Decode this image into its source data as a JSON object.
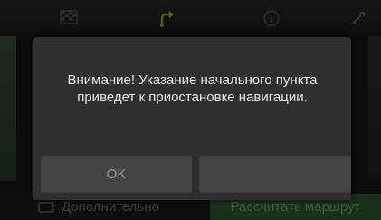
{
  "background": {
    "top_icons": [
      "checkered-flag-icon",
      "route-arrow-icon",
      "info-icon",
      "settings-icon"
    ],
    "more_button": {
      "label": "Дополнительно",
      "icon": "list-icon"
    },
    "calculate_route_button": {
      "label": "Рассчитать маршрут",
      "color": "#2d5a2d"
    }
  },
  "dialog": {
    "message": "Внимание! Указание начального пункта приведет к приостановке навигации.",
    "ok_label": "OK",
    "second_label": ""
  }
}
